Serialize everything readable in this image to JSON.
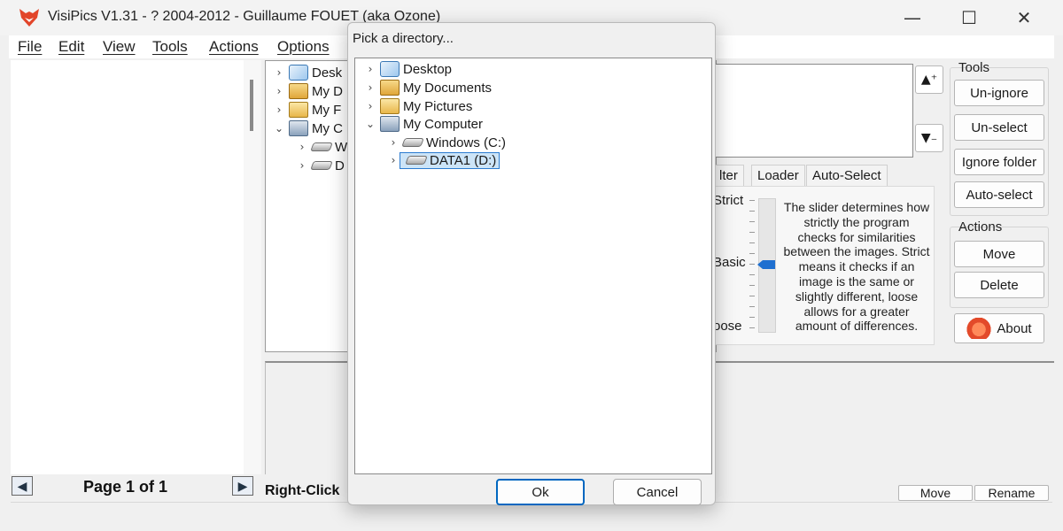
{
  "window": {
    "title": "VisiPics V1.31 - ? 2004-2012 - Guillaume FOUET (aka Ozone)",
    "controls": [
      "minimize",
      "maximize",
      "close"
    ]
  },
  "menu": [
    "File",
    "Edit",
    "View",
    "Tools",
    "Actions",
    "Options"
  ],
  "left_panel": {
    "page_label": "Page 1 of 1"
  },
  "tree_background": {
    "items": [
      {
        "label": "Desk",
        "icon": "desktop-icon"
      },
      {
        "label": "My D",
        "icon": "documents-folder-icon"
      },
      {
        "label": "My F",
        "icon": "pictures-folder-icon"
      },
      {
        "label": "My C",
        "icon": "computer-icon"
      },
      {
        "label": "W",
        "icon": "drive-icon"
      },
      {
        "label": "D",
        "icon": "drive-icon"
      }
    ]
  },
  "bottom": {
    "right_click_text": "Right-Click"
  },
  "tabs": [
    "lter",
    "Loader",
    "Auto-Select"
  ],
  "filter_levels": [
    "Strict",
    "Basic",
    "oose"
  ],
  "filter_help": "The slider determines how strictly the program checks for similarities between the images. Strict means it checks if an image is the same or slightly different, loose allows for a greater amount of differences.",
  "tools": {
    "label": "Tools",
    "buttons": [
      "Un-ignore",
      "Un-select",
      "Ignore folder",
      "Auto-select"
    ]
  },
  "actions": {
    "label": "Actions",
    "buttons": [
      "Move",
      "Delete"
    ],
    "about": "About"
  },
  "status_buttons": [
    "Move",
    "Rename"
  ],
  "dialog": {
    "title": "Pick a directory...",
    "tree": [
      {
        "label": "Desktop",
        "icon": "desktop-icon",
        "expanded": false
      },
      {
        "label": "My Documents",
        "icon": "documents-folder-icon",
        "expanded": false
      },
      {
        "label": "My Pictures",
        "icon": "pictures-folder-icon",
        "expanded": false
      },
      {
        "label": "My Computer",
        "icon": "computer-icon",
        "expanded": true
      },
      {
        "label": "Windows (C:)",
        "icon": "drive-icon",
        "expanded": false
      },
      {
        "label": "DATA1 (D:)",
        "icon": "drive-icon",
        "expanded": false,
        "selected": true
      }
    ],
    "ok": "Ok",
    "cancel": "Cancel"
  },
  "colors": {
    "accent": "#0067c0",
    "selection": "#cce4f7",
    "slider": "#1e6fd0"
  }
}
